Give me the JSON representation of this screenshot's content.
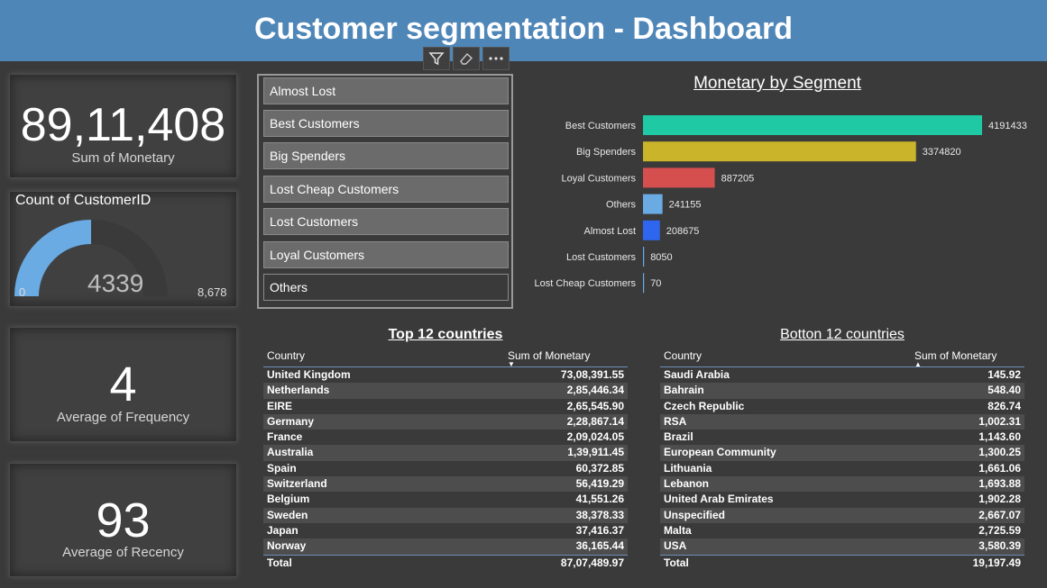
{
  "header": {
    "title": "Customer segmentation - Dashboard"
  },
  "toolbar": {
    "icons": [
      "filter-icon",
      "eraser-icon",
      "more-options-icon"
    ]
  },
  "kpi_monetary": {
    "value": "89,11,408",
    "label": "Sum of Monetary"
  },
  "gauge": {
    "title": "Count of CustomerID",
    "value": "4339",
    "min": "0",
    "max": "8,678",
    "fill_fraction": 0.5,
    "color": "#6aabe4"
  },
  "kpi_frequency": {
    "value": "4",
    "label": "Average of Frequency"
  },
  "kpi_recency": {
    "value": "93",
    "label": "Average of Recency"
  },
  "slicer": {
    "items": [
      {
        "label": "Almost Lost",
        "selected": true
      },
      {
        "label": "Best Customers",
        "selected": true
      },
      {
        "label": "Big Spenders",
        "selected": true
      },
      {
        "label": "Lost Cheap Customers",
        "selected": true
      },
      {
        "label": "Lost Customers",
        "selected": true
      },
      {
        "label": "Loyal Customers",
        "selected": true
      },
      {
        "label": "Others",
        "selected": false
      }
    ]
  },
  "chart_data": {
    "type": "bar",
    "orientation": "horizontal",
    "title": "Monetary by Segment",
    "categories": [
      "Best Customers",
      "Big Spenders",
      "Loyal Customers",
      "Others",
      "Almost Lost",
      "Lost Customers",
      "Lost Cheap Customers"
    ],
    "values": [
      4191433,
      3374820,
      887205,
      241155,
      208675,
      8050,
      70
    ],
    "value_labels": [
      "4191433",
      "3374820",
      "887205",
      "241155",
      "208675",
      "8050",
      "70"
    ],
    "colors": [
      "#1ec9a4",
      "#c9b42a",
      "#d64f4f",
      "#6aabe4",
      "#2e66f0",
      "#6aabe4",
      "#6aabe4"
    ],
    "xlim": [
      0,
      4191433
    ],
    "grid": false,
    "legend": "none"
  },
  "top_table": {
    "title": "Top 12 countries",
    "col_country": "Country",
    "col_value": "Sum of Monetary",
    "sort": "descending",
    "rows": [
      [
        "United Kingdom",
        "73,08,391.55"
      ],
      [
        "Netherlands",
        "2,85,446.34"
      ],
      [
        "EIRE",
        "2,65,545.90"
      ],
      [
        "Germany",
        "2,28,867.14"
      ],
      [
        "France",
        "2,09,024.05"
      ],
      [
        "Australia",
        "1,39,911.45"
      ],
      [
        "Spain",
        "60,372.85"
      ],
      [
        "Switzerland",
        "56,419.29"
      ],
      [
        "Belgium",
        "41,551.26"
      ],
      [
        "Sweden",
        "38,378.33"
      ],
      [
        "Japan",
        "37,416.37"
      ],
      [
        "Norway",
        "36,165.44"
      ]
    ],
    "total_label": "Total",
    "total_value": "87,07,489.97"
  },
  "bottom_table": {
    "title": "Botton 12 countries",
    "col_country": "Country",
    "col_value": "Sum of Monetary",
    "sort": "ascending",
    "rows": [
      [
        "Saudi Arabia",
        "145.92"
      ],
      [
        "Bahrain",
        "548.40"
      ],
      [
        "Czech Republic",
        "826.74"
      ],
      [
        "RSA",
        "1,002.31"
      ],
      [
        "Brazil",
        "1,143.60"
      ],
      [
        "European Community",
        "1,300.25"
      ],
      [
        "Lithuania",
        "1,661.06"
      ],
      [
        "Lebanon",
        "1,693.88"
      ],
      [
        "United Arab Emirates",
        "1,902.28"
      ],
      [
        "Unspecified",
        "2,667.07"
      ],
      [
        "Malta",
        "2,725.59"
      ],
      [
        "USA",
        "3,580.39"
      ]
    ],
    "total_label": "Total",
    "total_value": "19,197.49"
  }
}
